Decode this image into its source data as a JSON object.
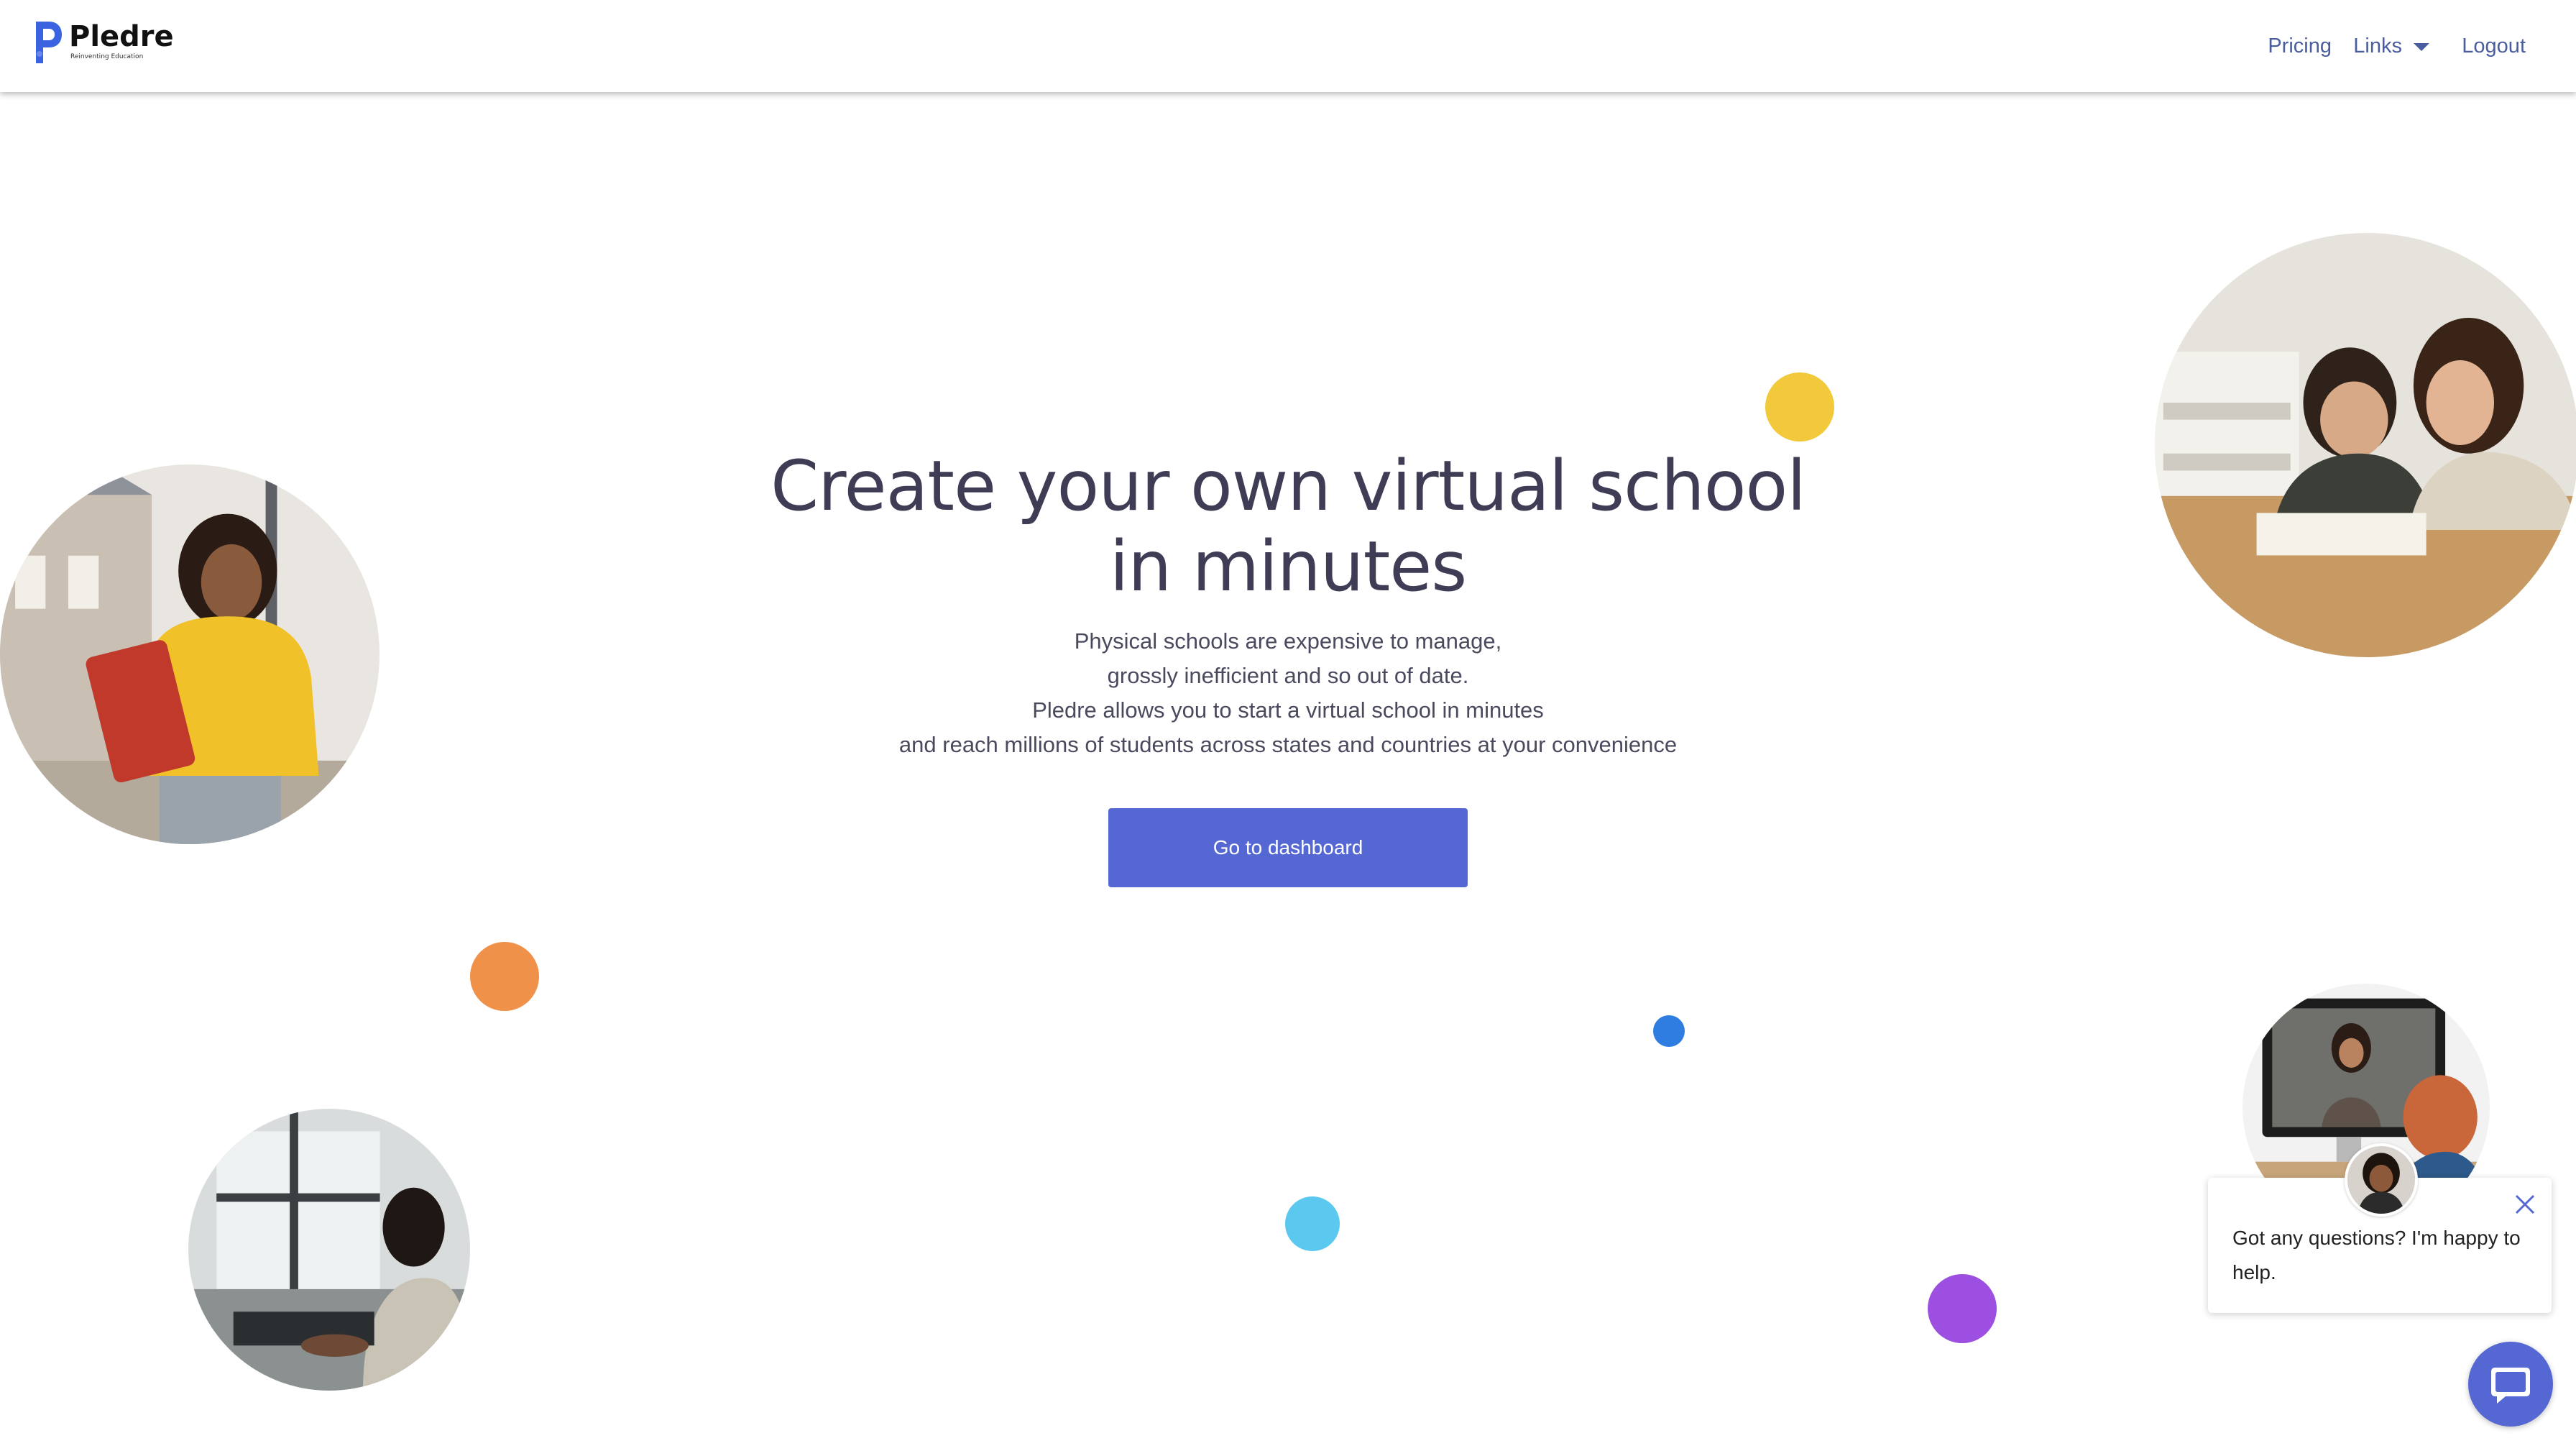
{
  "header": {
    "logo": {
      "name": "Pledre",
      "tagline": "Reinventing Education"
    },
    "nav": {
      "pricing": "Pricing",
      "links": "Links",
      "logout": "Logout"
    }
  },
  "hero": {
    "title_line1": "Create your own virtual school",
    "title_line2": "in minutes",
    "body": [
      "Physical schools are expensive to manage,",
      "grossly inefficient and so out of date.",
      "Pledre allows you to start a virtual school in minutes",
      "and reach millions of students across states and countries at your convenience"
    ],
    "cta_label": "Go to dashboard"
  },
  "chat": {
    "message": "Got any questions? I'm happy to help."
  },
  "colors": {
    "primary": "#5467d3",
    "nav_link": "#4a5d9e",
    "heading": "#3f3d56",
    "dot_yellow": "#f1c93b",
    "dot_orange": "#f0914a",
    "dot_blue": "#2f7de1",
    "dot_cyan": "#5bc8ef",
    "dot_purple": "#9c4fe0"
  },
  "icons": [
    "pledre-logo-icon",
    "chevron-down-icon",
    "close-icon",
    "chat-icon"
  ]
}
